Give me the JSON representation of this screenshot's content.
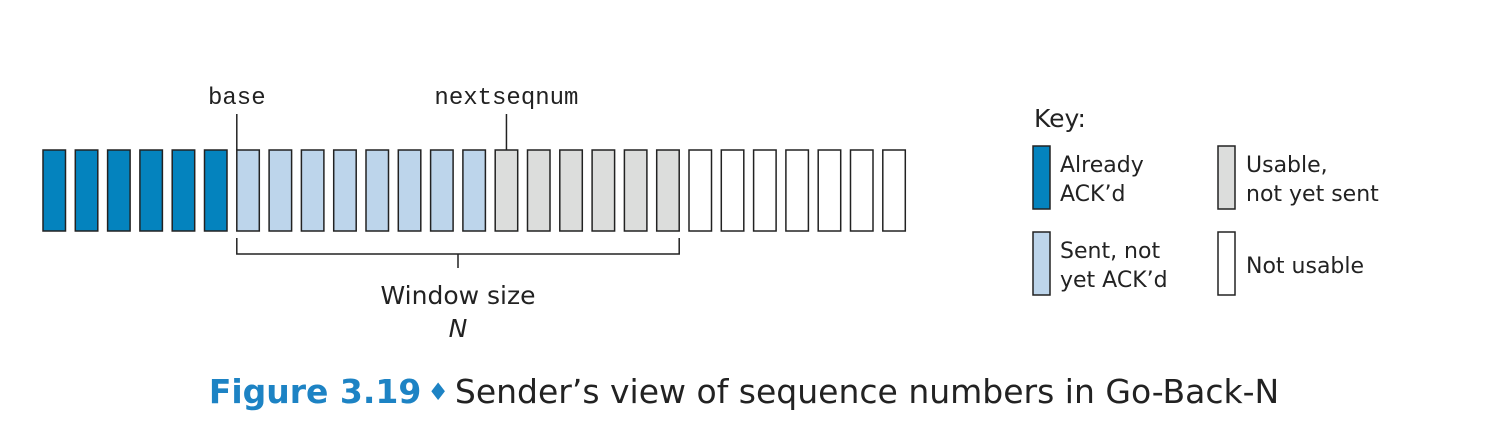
{
  "labels": {
    "base": "base",
    "nextseqnum": "nextseqnum",
    "window_size": "Window size",
    "window_n": "N"
  },
  "sequence": {
    "already_acked": 6,
    "sent_not_acked": 8,
    "usable_not_sent": 6,
    "not_usable": 7
  },
  "colors": {
    "already_acked": "#0483be",
    "sent_not_acked": "#bdd5eb",
    "usable_not_sent": "#dcdddc",
    "not_usable": "#ffffff",
    "stroke": "#222222",
    "caption_accent": "#1d83c4"
  },
  "key": {
    "title": "Key:",
    "items": [
      {
        "id": "already_acked",
        "lines": [
          "Already",
          "ACK’d"
        ]
      },
      {
        "id": "usable_not_sent",
        "lines": [
          "Usable,",
          "not yet sent"
        ]
      },
      {
        "id": "sent_not_acked",
        "lines": [
          "Sent, not",
          "yet ACK’d"
        ]
      },
      {
        "id": "not_usable",
        "lines": [
          "Not usable"
        ]
      }
    ]
  },
  "caption": {
    "figure": "Figure 3.19",
    "separator": "♦",
    "text": "Sender’s view of sequence numbers in Go-Back-N"
  }
}
